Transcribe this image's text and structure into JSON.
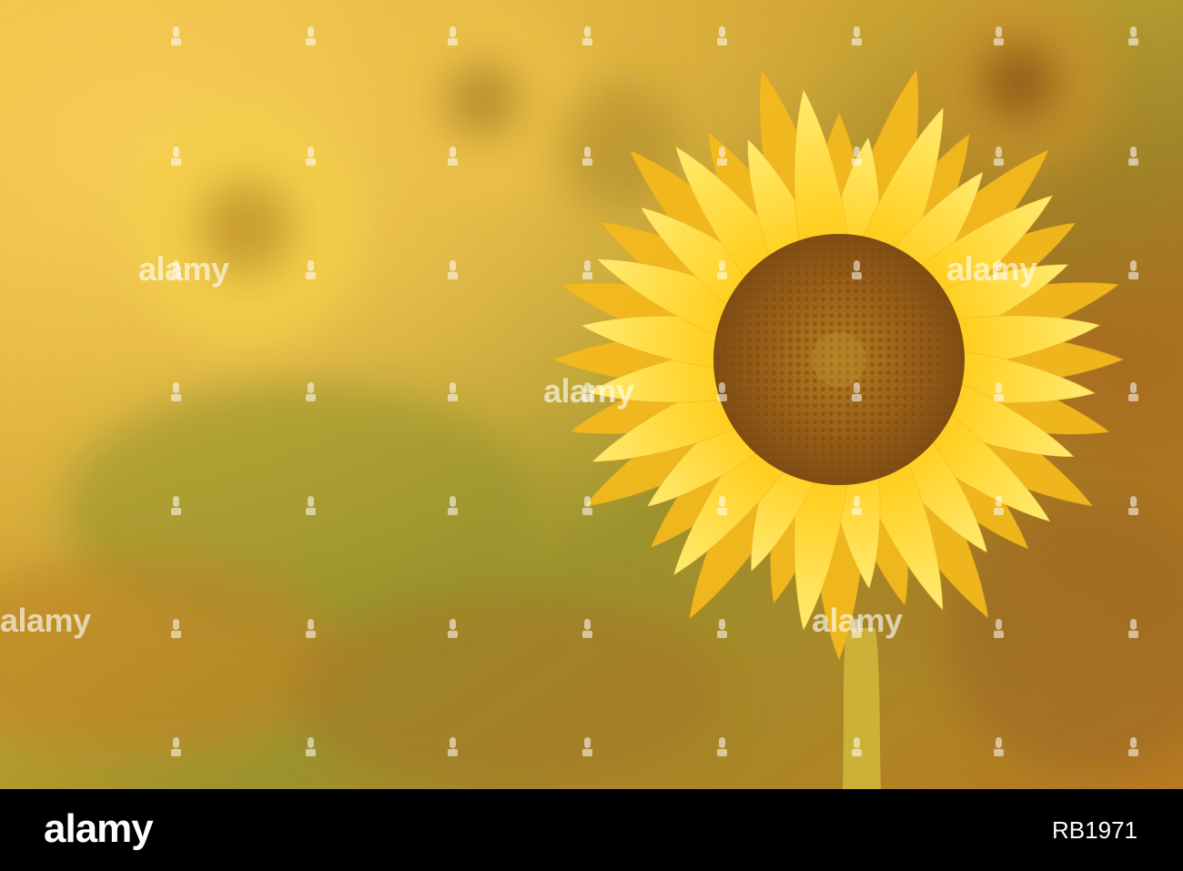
{
  "watermark": {
    "text": "alamy"
  },
  "footer": {
    "logo": "alamy",
    "image_id": "RB1971"
  },
  "colors": {
    "background_warm": "#d9a83a",
    "background_green": "#8a8f2e",
    "petal": "#ffd21f",
    "disc": "#9a5a12",
    "footer": "#000000"
  }
}
